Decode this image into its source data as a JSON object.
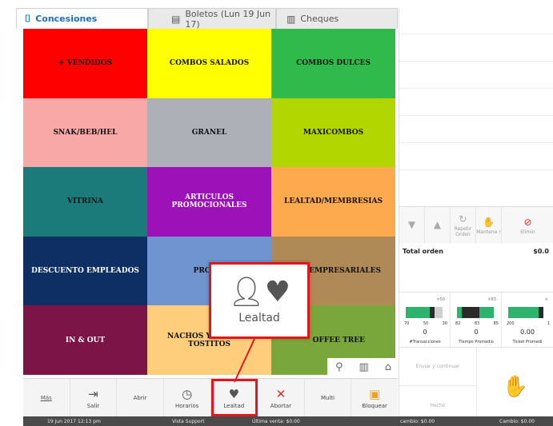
{
  "tabs": [
    {
      "label": "Concesiones",
      "icon": "popcorn-icon",
      "active": true
    },
    {
      "label": "Boletos (Lun 19 Jun 17)",
      "icon": "ticket-icon",
      "active": false
    },
    {
      "label": "Cheques",
      "icon": "cheque-icon",
      "active": false
    }
  ],
  "categories": [
    {
      "label": "+ VENDIDOS",
      "color": "#ff0000"
    },
    {
      "label": "COMBOS SALADOS",
      "color": "#ffff00"
    },
    {
      "label": "COMBOS DULCES",
      "color": "#2fba4b"
    },
    {
      "label": "SNAK/BEB/HEL",
      "color": "#f8a8a6"
    },
    {
      "label": "GRANEL",
      "color": "#adb1b7"
    },
    {
      "label": "MAXICOMBOS",
      "color": "#b2d600"
    },
    {
      "label": "VITRINA",
      "color": "#1b7b7b"
    },
    {
      "label": "ARTICULOS PROMOCIONALES",
      "color": "#9c12b8"
    },
    {
      "label": "LEALTAD/MEMBRESIAS",
      "color": "#fda94e"
    },
    {
      "label": "DESCUENTO EMPLEADOS",
      "color": "#0e2f63"
    },
    {
      "label": "PROMO",
      "color": "#6f94cf"
    },
    {
      "label": "EMPRESARIALES",
      "color": "#b08a56"
    },
    {
      "label": "IN & OUT",
      "color": "#7d1448"
    },
    {
      "label": "NACHOS Y COMBOS TOSTITOS",
      "color": "#ffce7c"
    },
    {
      "label": "OFFEE TREE",
      "color": "#7aa73b"
    }
  ],
  "grid_tools": {
    "search": "search-icon",
    "barcode": "barcode-icon",
    "home": "home-icon"
  },
  "controls": [
    {
      "label": "",
      "icon": "arrow-down-icon"
    },
    {
      "label": "",
      "icon": "arrow-up-icon"
    },
    {
      "label": "Repetir Orden",
      "icon": "repeat-icon"
    },
    {
      "label": "Mantene r",
      "icon": "hand-icon"
    },
    {
      "label": "Elimin",
      "icon": "delete-icon"
    }
  ],
  "order": {
    "total_label": "Total orden",
    "total_value": "$0.0"
  },
  "stats": [
    {
      "top": "≑50",
      "ticks": [
        "70",
        "50",
        "30"
      ],
      "value": "0",
      "label": "#Transacciones",
      "fill": 0.6
    },
    {
      "top": "≑83",
      "ticks": [
        "82",
        "83",
        "85"
      ],
      "value": "0",
      "label": "Tiempo Promedio",
      "fill": 0.55
    },
    {
      "top": "≑",
      "ticks": [
        "200",
        "1"
      ],
      "value": "0.00",
      "label": "Ticket Promedi",
      "fill": 0.5
    }
  ],
  "actions": {
    "send": "Enviar y continuar",
    "done": "Hecho"
  },
  "toolbar": [
    {
      "label": "Más",
      "icon": "",
      "kind": "more"
    },
    {
      "label": "Salir",
      "icon": "exit-icon"
    },
    {
      "label": "Abrir",
      "icon": ""
    },
    {
      "label": "Horarios",
      "icon": "schedule-icon"
    },
    {
      "label": "Lealtad",
      "icon": "loyalty-icon",
      "highlight": true
    },
    {
      "label": "Abortar",
      "icon": "abort-icon"
    },
    {
      "label": "Multi",
      "icon": ""
    },
    {
      "label": "Bloquear",
      "icon": "lock-icon"
    }
  ],
  "callout": {
    "label": "Lealtad",
    "icon": "loyalty-icon"
  },
  "status": {
    "datetime": "19 Jun 2017 12:13 pm",
    "user": "Vista Support",
    "last_sale": "Última venta: $0.00",
    "change1": "cambio: $0.00",
    "change2": "Cambio: $0.00"
  }
}
